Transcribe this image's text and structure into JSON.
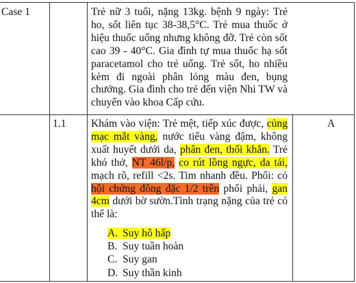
{
  "case": {
    "label": "Case 1",
    "text": "Trẻ nữ 3 tuổi, nặng 13kg.  bệnh 9 ngày: Trẻ ho, sốt liên tục 38-38,5°C. Trẻ mua thuốc ở hiệu thuốc uống nhưng không đỡ. Trẻ còn sốt cao 39 - 40°C. Gia đình tự mua thuốc hạ sốt paracetamol cho trẻ uống. Trẻ sốt, ho nhiều kèm đi ngoài phân lỏng màu đen, bụng chướng. Gia đình cho trẻ đến viện Nhi TW và chuyển vào khoa Cấp cứu."
  },
  "question": {
    "number": "1.1",
    "answer": "A",
    "stem": [
      {
        "text": "Khám vào viện: Trẻ mệt, tiếp xúc được, "
      },
      {
        "text": "củng mạc mắt vàng,",
        "hl": "yellow"
      },
      {
        "text": " nước tiểu vàng đậm, không xuất huyết dưới da, "
      },
      {
        "text": "phân đen, thối khắn.",
        "hl": "yellow"
      },
      {
        "text": " Trẻ khó thở, "
      },
      {
        "text": "NT 46l/p,",
        "hl": "orange"
      },
      {
        "text": " "
      },
      {
        "text": "co rút lồng ngực, da tái,",
        "hl": "yellow"
      },
      {
        "text": " mạch rõ, refill <2s. Tim nhanh đều. Phổi: có "
      },
      {
        "text": "hội chứng đông đặc 1/2 trên",
        "hl": "orange"
      },
      {
        "text": " phổi phải, "
      },
      {
        "text": "gan 4cm",
        "hl": "yellow"
      },
      {
        "text": " dưới bờ sườn.Tình trạng nặng của trẻ có thể là:"
      }
    ],
    "options": [
      {
        "letter": "A.",
        "text": "Suy hô hấp",
        "highlighted": true
      },
      {
        "letter": "B.",
        "text": "Suy tuần hoàn",
        "highlighted": false
      },
      {
        "letter": "C.",
        "text": "Suy gan",
        "highlighted": false
      },
      {
        "letter": "D.",
        "text": "Suy thần kinh",
        "highlighted": false
      }
    ]
  },
  "colors": {
    "highlight_yellow": "#ffff1f",
    "highlight_orange": "#f26a2b",
    "rule": "#333333"
  }
}
